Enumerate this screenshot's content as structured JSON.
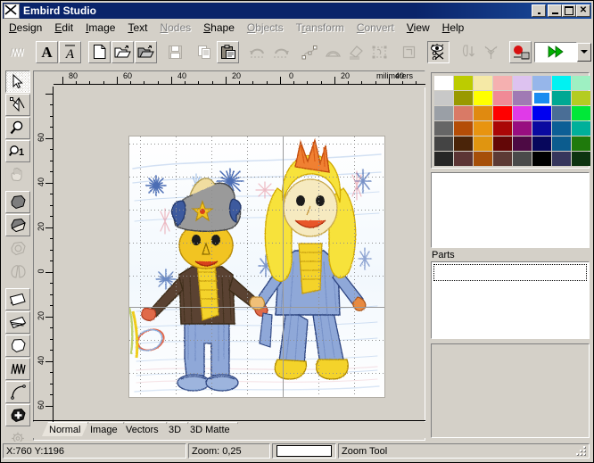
{
  "window": {
    "title": "Embird Studio",
    "icon": "embird-logo-icon",
    "buttons": [
      {
        "name": "restore-small-button",
        "glyph": "dot"
      },
      {
        "name": "minimize-button",
        "glyph": "minimize"
      },
      {
        "name": "maximize-button",
        "glyph": "maximize"
      },
      {
        "name": "close-button",
        "glyph": "close",
        "label": "✕"
      }
    ]
  },
  "menubar": {
    "items": [
      {
        "label": "Design",
        "accel": "D",
        "disabled": false
      },
      {
        "label": "Edit",
        "accel": "E",
        "disabled": false
      },
      {
        "label": "Image",
        "accel": "I",
        "disabled": false
      },
      {
        "label": "Text",
        "accel": "T",
        "disabled": false
      },
      {
        "label": "Nodes",
        "accel": "N",
        "disabled": true
      },
      {
        "label": "Shape",
        "accel": "S",
        "disabled": false
      },
      {
        "label": "Objects",
        "accel": "O",
        "disabled": true
      },
      {
        "label": "Transform",
        "accel": "r",
        "disabled": true
      },
      {
        "label": "Convert",
        "accel": "C",
        "disabled": true
      },
      {
        "label": "View",
        "accel": "V",
        "disabled": false
      },
      {
        "label": "Help",
        "accel": "H",
        "disabled": false
      }
    ]
  },
  "toolbar": {
    "buttons": [
      {
        "name": "stitches-icon",
        "state": "flat",
        "tip": "Stitches"
      },
      {
        "name": "text-letter-a-icon",
        "state": "raised",
        "tip": "Text"
      },
      {
        "name": "text-script-a-icon",
        "state": "raised",
        "tip": "Script Text"
      },
      {
        "name": "new-file-icon",
        "state": "raised",
        "tip": "New"
      },
      {
        "name": "open-folder-icon",
        "state": "raised",
        "tip": "Open"
      },
      {
        "name": "open-image-icon",
        "state": "raised",
        "tip": "Open Image"
      },
      {
        "name": "save-floppy-icon",
        "state": "flat",
        "tip": "Save"
      },
      {
        "name": "copy-icon",
        "state": "flat",
        "tip": "Copy"
      },
      {
        "name": "paste-clipboard-icon",
        "state": "raised",
        "tip": "Paste"
      },
      {
        "name": "undo-icon",
        "state": "flat",
        "tip": "Undo"
      },
      {
        "name": "redo-icon",
        "state": "flat",
        "tip": "Redo"
      },
      {
        "name": "node-edit-icon",
        "state": "flat",
        "tip": "Node Edit"
      },
      {
        "name": "arc-icon",
        "state": "flat",
        "tip": "Arc"
      },
      {
        "name": "fill-stitch-icon",
        "state": "flat",
        "tip": "Fill"
      },
      {
        "name": "select-region-icon",
        "state": "flat",
        "tip": "Select Region"
      },
      {
        "name": "frame-icon",
        "state": "flat",
        "tip": "Frame"
      },
      {
        "name": "eye-scissors-icon",
        "state": "pressed",
        "tip": "Cut / Preview"
      },
      {
        "name": "needle-down-icon",
        "state": "flat",
        "tip": "Needle"
      },
      {
        "name": "branch-icon",
        "state": "flat",
        "tip": "Branching"
      },
      {
        "name": "record-machine-icon",
        "state": "raised",
        "tip": "Machine"
      }
    ],
    "run_combo": {
      "name": "run-forward-combo",
      "icon": "double-green-arrow-icon"
    }
  },
  "toolpalette": {
    "tools": [
      {
        "name": "tool-select-arrow",
        "state": "pressed",
        "label": "Select"
      },
      {
        "name": "tool-node-edit",
        "state": "raised",
        "label": "Node Edit"
      },
      {
        "name": "tool-zoom",
        "state": "raised",
        "label": "Zoom Tool"
      },
      {
        "name": "tool-zoom-1-1",
        "state": "raised",
        "label": "Zoom 1:1"
      },
      {
        "name": "tool-pan-hand",
        "state": "flat",
        "label": "Pan"
      },
      {
        "name": "tool-fill-dark",
        "state": "raised",
        "label": "Fill"
      },
      {
        "name": "tool-fill-light",
        "state": "raised",
        "label": "Gradient Fill"
      },
      {
        "name": "tool-hole",
        "state": "flat",
        "label": "Hole"
      },
      {
        "name": "tool-split",
        "state": "flat",
        "label": "Split"
      },
      {
        "name": "tool-satin-column",
        "state": "raised",
        "label": "Satin Column"
      },
      {
        "name": "tool-satin-border",
        "state": "raised",
        "label": "Satin Border"
      },
      {
        "name": "tool-outline-shape",
        "state": "raised",
        "label": "Outline"
      },
      {
        "name": "tool-zigzag-run",
        "state": "raised",
        "label": "Zigzag Run"
      },
      {
        "name": "tool-curve-line",
        "state": "raised",
        "label": "Curve"
      },
      {
        "name": "tool-shape-filled",
        "state": "raised",
        "label": "Filled Shape"
      },
      {
        "name": "tool-settings-gear",
        "state": "flat",
        "label": "Settings"
      }
    ]
  },
  "rulers": {
    "unit_label": "milimeters",
    "horizontal_labels": [
      "80",
      "60",
      "40",
      "20",
      "0",
      "20",
      "40"
    ],
    "vertical_labels": [
      "60",
      "40",
      "20",
      "0",
      "20",
      "40",
      "60"
    ]
  },
  "canvas": {
    "artboard_name": "design-artboard",
    "artwork": "childrens-crayon-drawing-two-figures"
  },
  "rightpanel": {
    "palette_name": "thread-color-palette",
    "selected_swatch_index": 13,
    "colors": [
      "#ffffff",
      "#bccc00",
      "#f5e9a6",
      "#f5b0b0",
      "#ddc2f0",
      "#96b6ea",
      "#00f2f2",
      "#9ef0c2",
      "#c8c8c8",
      "#999900",
      "#ffff00",
      "#f08a96",
      "#a07ab4",
      "#1a8cf0",
      "#00a893",
      "#b4cc22",
      "#9a9fa6",
      "#d97a66",
      "#e08a10",
      "#ff0000",
      "#e03ae8",
      "#0000f0",
      "#4a6e96",
      "#00e838",
      "#666666",
      "#b44d07",
      "#e89410",
      "#aa0707",
      "#980e80",
      "#0a0aa0",
      "#0d5f96",
      "#00b09a",
      "#444444",
      "#4a2409",
      "#e09510",
      "#630707",
      "#4d0a44",
      "#07075c",
      "#0c5c8e",
      "#1f7a0c",
      "#262626",
      "#5c3535",
      "#a64f09",
      "#5c3a35",
      "#4a4a4a",
      "#000000",
      "#36365c",
      "#0d3310"
    ],
    "preview_name": "design-preview-pane",
    "parts_label": "Parts",
    "parts_rows": [
      ""
    ],
    "lower_pane_name": "properties-pane"
  },
  "tabs": {
    "items": [
      {
        "label": "Normal",
        "active": true
      },
      {
        "label": "Image",
        "active": false
      },
      {
        "label": "Vectors",
        "active": false
      },
      {
        "label": "3D",
        "active": false
      },
      {
        "label": "3D Matte",
        "active": false
      }
    ]
  },
  "statusbar": {
    "coords": "X:760  Y:1196",
    "zoom": "Zoom: 0,25",
    "color_swatch": "#ffffff",
    "tool": "Zoom Tool"
  }
}
